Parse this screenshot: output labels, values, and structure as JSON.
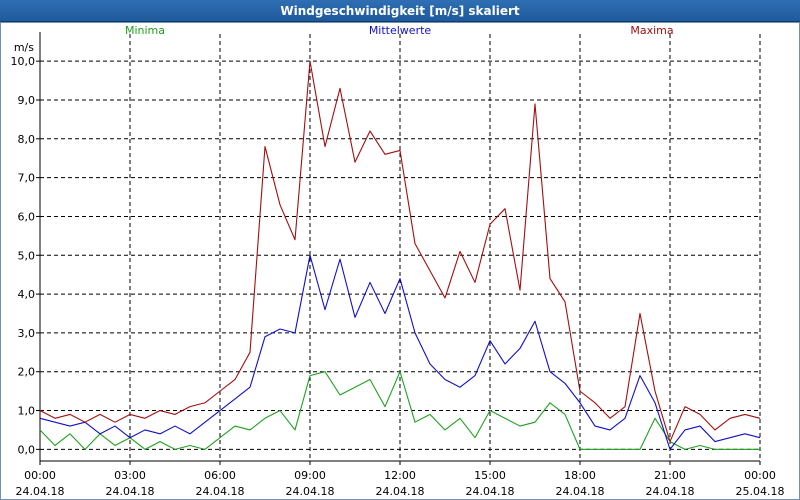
{
  "window": {
    "title": "Windgeschwindigkeit [m/s] skaliert"
  },
  "colors": {
    "minima": "#20a020",
    "mittel": "#1010c8",
    "maxima": "#a01010",
    "grid": "#000000",
    "title_bg": "#1f5a9c"
  },
  "chart_data": {
    "type": "line",
    "title": "Windgeschwindigkeit [m/s] skaliert",
    "ylabel": "m/s",
    "xlabel": "",
    "ylim": [
      -0.3,
      10.7
    ],
    "xlim": [
      0,
      24
    ],
    "grid": true,
    "legend_placement": "top",
    "y_ticks": [
      "0,0",
      "1,0",
      "2,0",
      "3,0",
      "4,0",
      "5,0",
      "6,0",
      "7,0",
      "8,0",
      "9,0",
      "10,0"
    ],
    "x_ticks": [
      {
        "time": "00:00",
        "date": "24.04.18"
      },
      {
        "time": "03:00",
        "date": "24.04.18"
      },
      {
        "time": "06:00",
        "date": "24.04.18"
      },
      {
        "time": "09:00",
        "date": "24.04.18"
      },
      {
        "time": "12:00",
        "date": "24.04.18"
      },
      {
        "time": "15:00",
        "date": "24.04.18"
      },
      {
        "time": "18:00",
        "date": "24.04.18"
      },
      {
        "time": "21:00",
        "date": "24.04.18"
      },
      {
        "time": "00:00",
        "date": "25.04.18"
      }
    ],
    "x_hours": [
      0,
      0.5,
      1,
      1.5,
      2,
      2.5,
      3,
      3.5,
      4,
      4.5,
      5,
      5.5,
      6,
      6.5,
      7,
      7.5,
      8,
      8.5,
      9,
      9.5,
      10,
      10.5,
      11,
      11.5,
      12,
      12.5,
      13,
      13.5,
      14,
      14.5,
      15,
      15.5,
      16,
      16.5,
      17,
      17.5,
      18,
      18.5,
      19,
      19.5,
      20,
      20.5,
      21,
      21.5,
      22,
      22.5,
      23,
      23.5,
      24
    ],
    "series": [
      {
        "name": "Minima",
        "color": "#20a020",
        "values": [
          0.5,
          0.1,
          0.4,
          0.0,
          0.4,
          0.1,
          0.3,
          0.0,
          0.2,
          0.0,
          0.1,
          0.0,
          0.3,
          0.6,
          0.5,
          0.8,
          1.0,
          0.5,
          1.9,
          2.0,
          1.4,
          1.6,
          1.8,
          1.1,
          2.0,
          0.7,
          0.9,
          0.5,
          0.8,
          0.3,
          1.0,
          0.8,
          0.6,
          0.7,
          1.2,
          0.9,
          0.0,
          0.0,
          0.0,
          0.0,
          0.0,
          0.8,
          0.2,
          0.0,
          0.1,
          0.0,
          0.0,
          0.0,
          0.0
        ]
      },
      {
        "name": "Mittelwerte",
        "color": "#1010c8",
        "values": [
          0.8,
          0.7,
          0.6,
          0.7,
          0.4,
          0.6,
          0.3,
          0.5,
          0.4,
          0.6,
          0.4,
          0.7,
          1.0,
          1.3,
          1.6,
          2.9,
          3.1,
          3.0,
          5.0,
          3.6,
          4.9,
          3.4,
          4.3,
          3.5,
          4.4,
          3.0,
          2.2,
          1.8,
          1.6,
          1.9,
          2.8,
          2.2,
          2.6,
          3.3,
          2.0,
          1.7,
          1.2,
          0.6,
          0.5,
          0.8,
          1.9,
          1.2,
          0.0,
          0.5,
          0.6,
          0.2,
          0.3,
          0.4,
          0.3
        ]
      },
      {
        "name": "Maxima",
        "color": "#a01010",
        "values": [
          1.0,
          0.8,
          0.9,
          0.7,
          0.9,
          0.7,
          0.9,
          0.8,
          1.0,
          0.9,
          1.1,
          1.2,
          1.5,
          1.8,
          2.5,
          7.8,
          6.3,
          5.4,
          10.0,
          7.8,
          9.3,
          7.4,
          8.2,
          7.6,
          7.7,
          5.3,
          4.6,
          3.9,
          5.1,
          4.3,
          5.8,
          6.2,
          4.1,
          8.9,
          4.4,
          3.8,
          1.5,
          1.2,
          0.8,
          1.1,
          3.5,
          1.5,
          0.2,
          1.1,
          0.9,
          0.5,
          0.8,
          0.9,
          0.8
        ]
      }
    ]
  }
}
